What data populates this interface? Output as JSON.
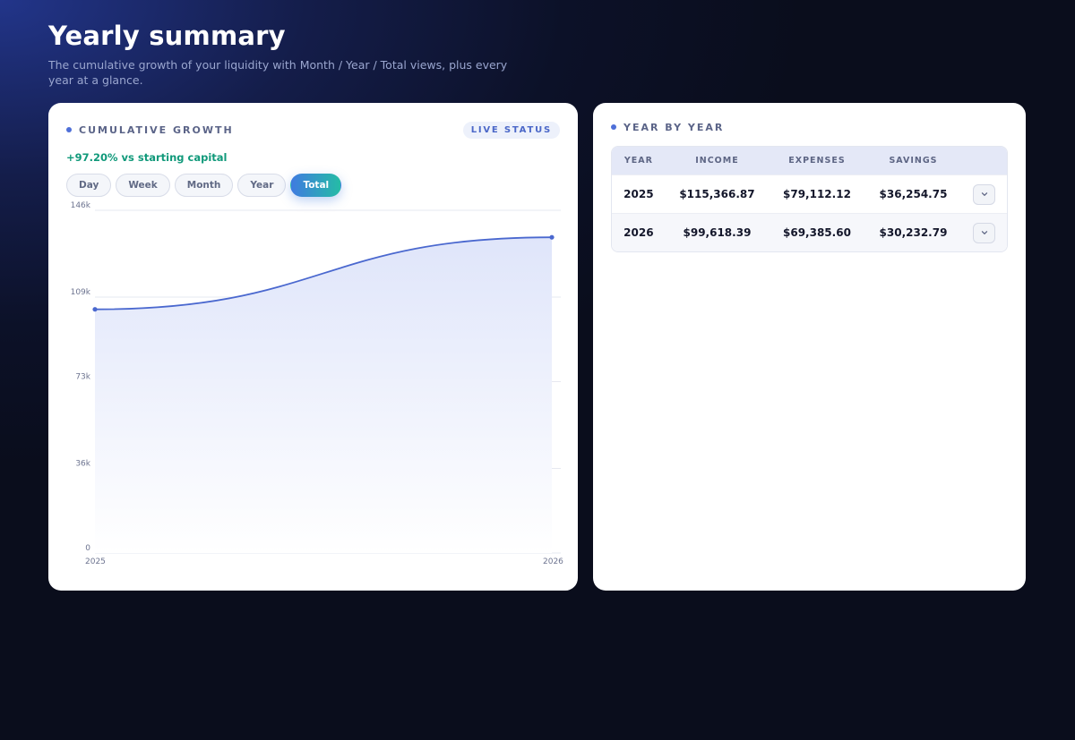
{
  "header": {
    "title": "Yearly summary",
    "subtitle": "The cumulative growth of your liquidity with Month / Year / Total views, plus every year at a glance."
  },
  "growth_card": {
    "label": "CUMULATIVE GROWTH",
    "badge": "LIVE STATUS",
    "change_text": "+97.20% vs starting capital",
    "tabs": [
      "Day",
      "Week",
      "Month",
      "Year",
      "Total"
    ],
    "active_tab": "Total"
  },
  "chart_data": {
    "type": "area",
    "x": [
      "2025",
      "2026"
    ],
    "values": [
      103800,
      134500
    ],
    "ylim": [
      0,
      146000
    ],
    "yticks": [
      0,
      36000,
      73000,
      109000,
      146000
    ],
    "ytick_labels": [
      "0",
      "36k",
      "73k",
      "109k",
      "146k"
    ],
    "xtick_labels": [
      "2025",
      "2026"
    ],
    "grid": true,
    "colors": {
      "line": "#4a68cf",
      "fill_top": "#dfe5fa",
      "fill_bottom": "#ffffff"
    }
  },
  "year_card": {
    "label": "YEAR BY YEAR",
    "columns": [
      "YEAR",
      "INCOME",
      "EXPENSES",
      "SAVINGS"
    ],
    "rows": [
      {
        "year": "2025",
        "income": "$115,366.87",
        "expenses": "$79,112.12",
        "savings": "$36,254.75"
      },
      {
        "year": "2026",
        "income": "$99,618.39",
        "expenses": "$69,385.60",
        "savings": "$30,232.79"
      }
    ],
    "expand_icon": "chevron-down-icon"
  },
  "colors": {
    "accent": "#4e6fd8",
    "positive": "#10997a",
    "tab_gradient_start": "#3f7be0",
    "tab_gradient_end": "#25bca6"
  }
}
